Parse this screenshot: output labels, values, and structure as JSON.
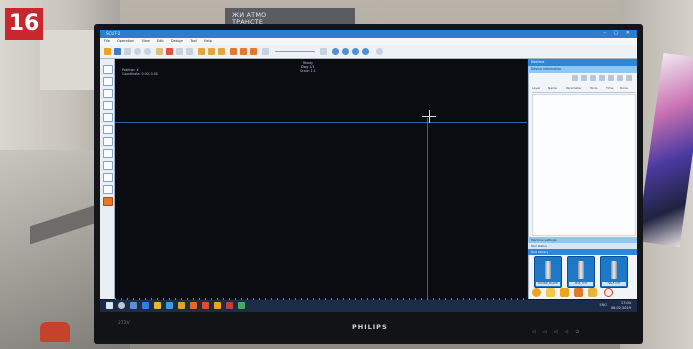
{
  "badge": {
    "number": "16"
  },
  "signage": {
    "top_sign": "ЖИ АТМО\nТРАНСТЕ"
  },
  "monitor": {
    "brand": "PHILIPS",
    "model_label": "272V",
    "osd_buttons": "◁ ◁ ◁ ◁ ⏻"
  },
  "app": {
    "title": "SCUT-2",
    "window_controls": "– ▢ ✕",
    "menu": [
      "File",
      "Operation",
      "View",
      "Edit",
      "Design",
      "Tool",
      "Help"
    ],
    "canvas": {
      "info_line1": "Position: X",
      "info_line2": "Coordinate: 0.00, 0.00",
      "center_line1": "Ready",
      "center_line2": "Dwg 1/1",
      "center_line3": "Scale: 1:1"
    },
    "panel": {
      "header": "Machine",
      "subheader": "Device information",
      "columns": [
        "Layer",
        "Name",
        "Parameter",
        "Tools",
        "Time",
        "Done"
      ],
      "section_a": "Machine settings",
      "section_b": "Tool status",
      "section_c": "Tool Library",
      "tool_cards": [
        "ROUND_BLADE",
        "KISS_CUT",
        "HALF CUT"
      ]
    },
    "taskbar": {
      "tray": "ENG",
      "time": "17:04",
      "date": "06.02.2019"
    }
  },
  "colors": {
    "badge": "#c8282d",
    "titlebar": "#2d7ccf",
    "canvas": "#0a0c12",
    "guide_lines": "#3a62a6",
    "taskbar": "#1c2b47"
  }
}
